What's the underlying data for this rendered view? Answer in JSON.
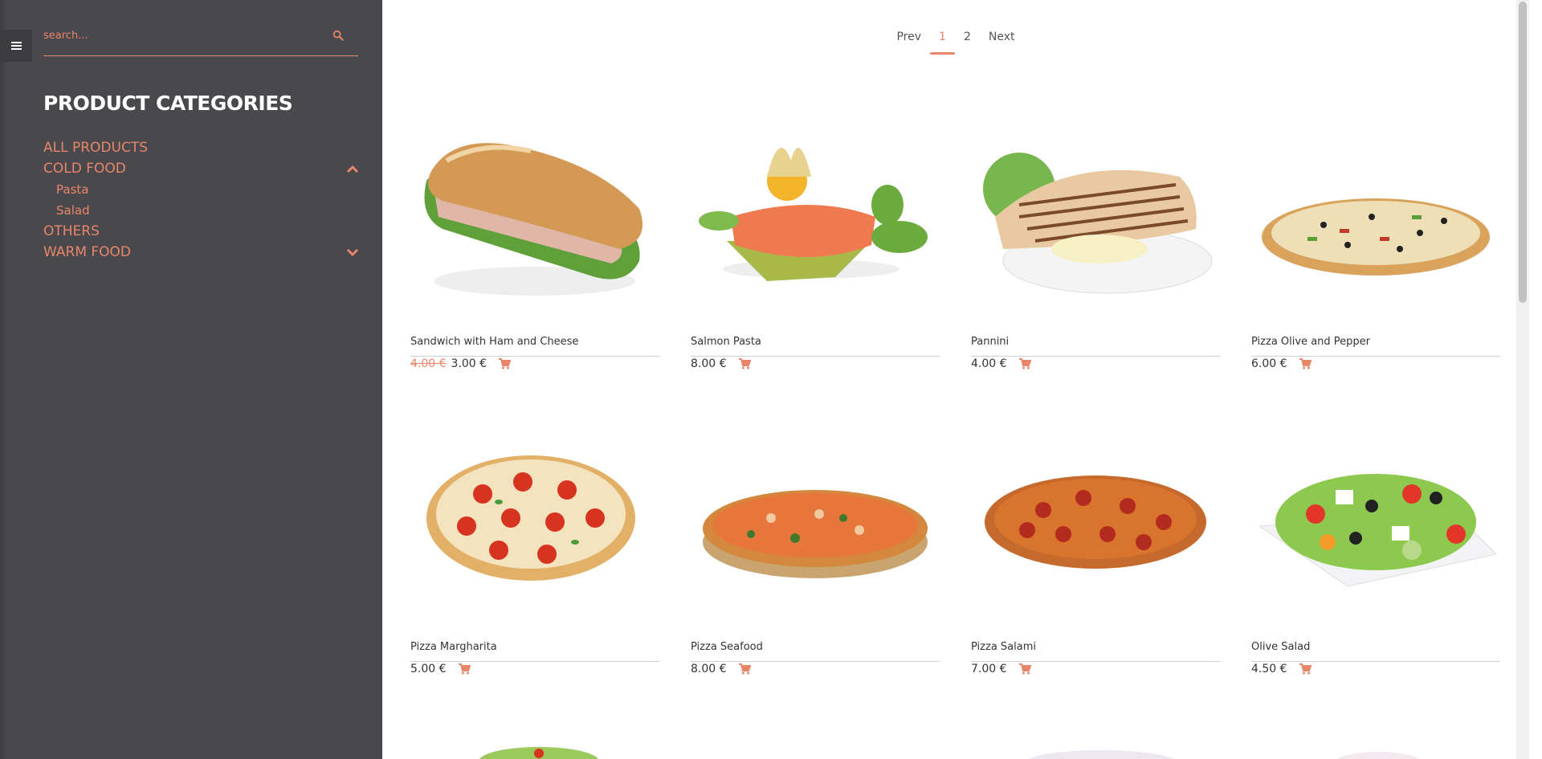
{
  "search": {
    "placeholder": "search..."
  },
  "sidebar": {
    "title": "PRODUCT CATEGORIES",
    "categories": [
      {
        "label": "ALL PRODUCTS"
      },
      {
        "label": "COLD FOOD",
        "expanded": true,
        "children": [
          {
            "label": "Pasta"
          },
          {
            "label": "Salad"
          }
        ]
      },
      {
        "label": "OTHERS"
      },
      {
        "label": "WARM FOOD",
        "expanded": false
      }
    ]
  },
  "pagination": {
    "prev": "Prev",
    "pages": [
      "1",
      "2"
    ],
    "current": "1",
    "next": "Next"
  },
  "products": [
    {
      "name": "Sandwich with Ham and Cheese",
      "old_price": "4.00 €",
      "price": "3.00 €",
      "image": "sandwich"
    },
    {
      "name": "Salmon Pasta",
      "price": "8.00 €",
      "image": "salmon"
    },
    {
      "name": "Pannini",
      "price": "4.00 €",
      "image": "pannini"
    },
    {
      "name": "Pizza Olive and Pepper",
      "price": "6.00 €",
      "image": "pizza-olive"
    },
    {
      "name": "Pizza Margharita",
      "price": "5.00 €",
      "image": "pizza-margharita"
    },
    {
      "name": "Pizza Seafood",
      "price": "8.00 €",
      "image": "pizza-seafood"
    },
    {
      "name": "Pizza Salami",
      "price": "7.00 €",
      "image": "pizza-salami"
    },
    {
      "name": "Olive Salad",
      "price": "4.50 €",
      "image": "olive-salad"
    }
  ],
  "colors": {
    "accent": "#e8866a",
    "sidebar": "#49484d",
    "toggle_bg": "#3c3b40"
  }
}
